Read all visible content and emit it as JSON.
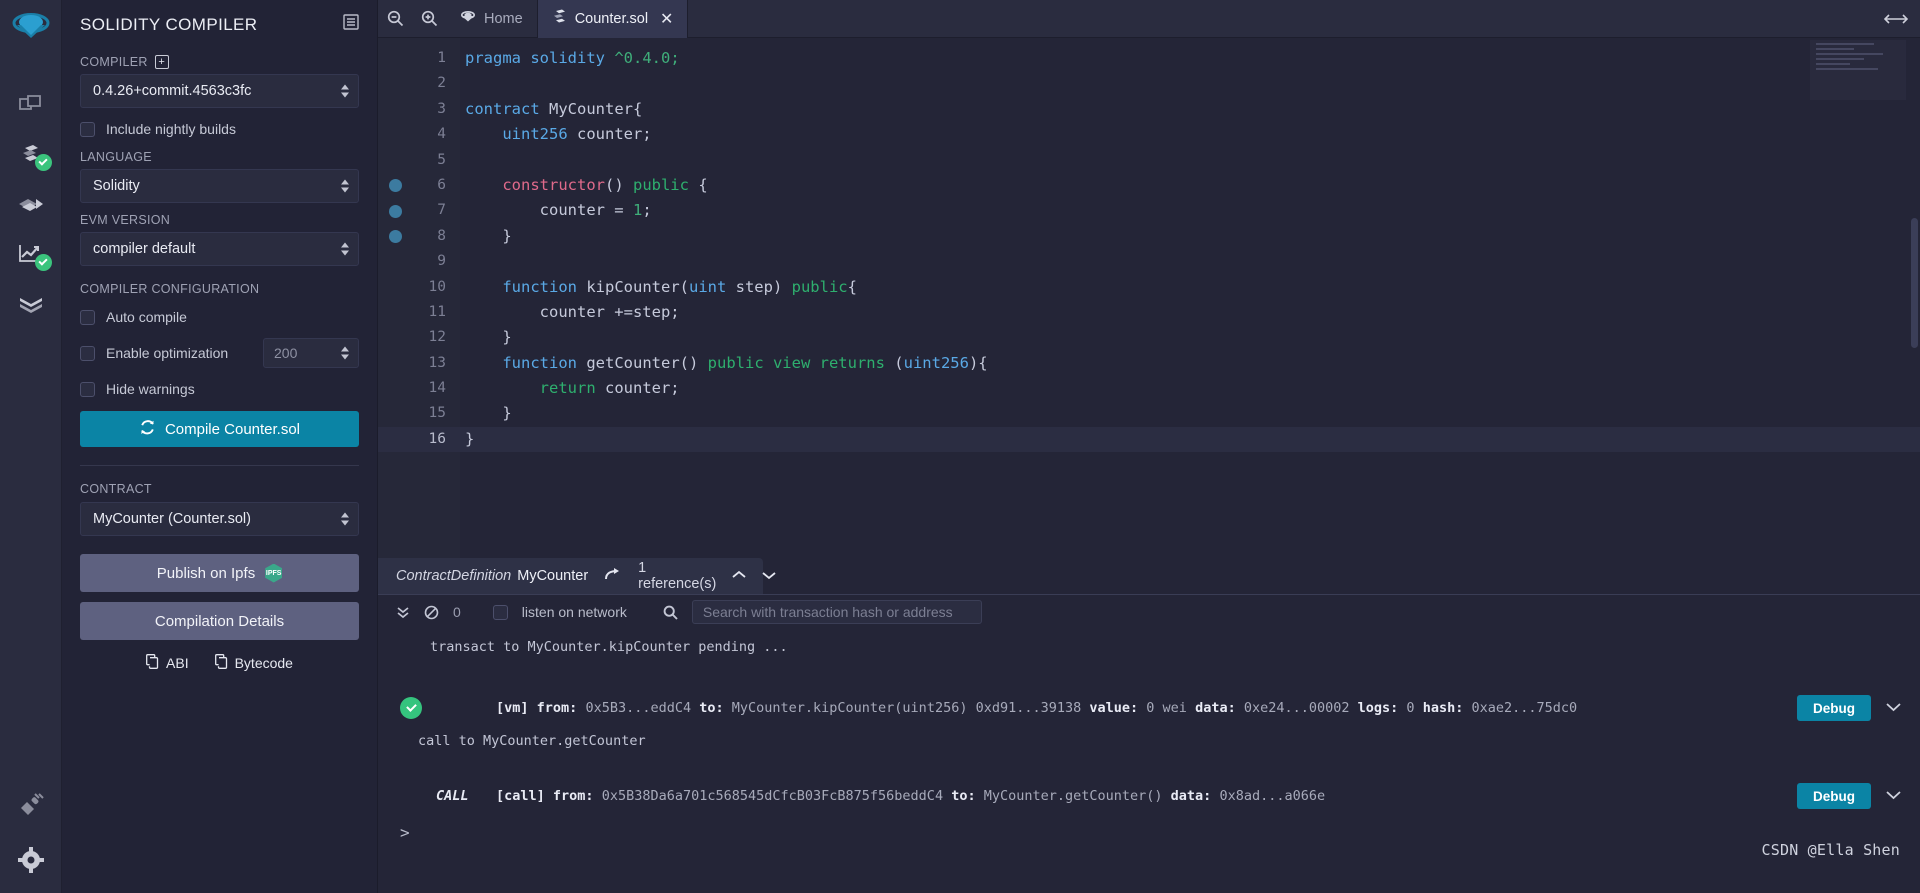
{
  "rail": {
    "items": [
      {
        "name": "logo",
        "icon": "remix-logo-icon",
        "badge": false
      },
      {
        "name": "file-explorer",
        "icon": "files-icon",
        "badge": false
      },
      {
        "name": "solidity-compiler",
        "icon": "solidity-compiler-icon",
        "badge": true
      },
      {
        "name": "deploy-run",
        "icon": "deploy-run-icon",
        "badge": false
      },
      {
        "name": "analysis",
        "icon": "analysis-chart-icon",
        "badge": true
      },
      {
        "name": "debugger",
        "icon": "debugger-chevrons-icon",
        "badge": false
      }
    ],
    "bottom": [
      {
        "name": "plugin-manager",
        "icon": "plug-icon"
      },
      {
        "name": "settings",
        "icon": "gear-icon"
      }
    ]
  },
  "panel": {
    "title": "SOLIDITY COMPILER",
    "head_icon": "list-view-icon",
    "compiler_label": "COMPILER",
    "compiler_plus": "+",
    "compiler_version": "0.4.26+commit.4563c3fc",
    "nightly_label": "Include nightly builds",
    "language_label": "LANGUAGE",
    "language_value": "Solidity",
    "evm_label": "EVM VERSION",
    "evm_value": "compiler default",
    "config_label": "COMPILER CONFIGURATION",
    "auto_compile_label": "Auto compile",
    "enable_opt_label": "Enable optimization",
    "runs_value": "200",
    "hide_warnings_label": "Hide warnings",
    "compile_button": "Compile Counter.sol",
    "compile_icon": "refresh-icon",
    "contract_label": "CONTRACT",
    "contract_value": "MyCounter (Counter.sol)",
    "publish_button": "Publish on Ipfs",
    "publish_badge": "IPFS",
    "details_button": "Compilation Details",
    "abi_label": "ABI",
    "bytecode_label": "Bytecode",
    "copy_icon": "copy-icon"
  },
  "tabbar": {
    "zoom_out": "zoom-out-icon",
    "zoom_in": "zoom-in-icon",
    "tabs": [
      {
        "label": "Home",
        "icon": "remix-home-icon",
        "active": false,
        "closable": false
      },
      {
        "label": "Counter.sol",
        "icon": "solidity-file-icon",
        "active": true,
        "closable": true
      }
    ],
    "close_glyph": "✕",
    "collapse_icon": "expand-arrows-icon"
  },
  "editor": {
    "lines": [
      {
        "n": "1",
        "bp": false,
        "indent": 0,
        "tokens": [
          {
            "t": "pragma ",
            "c": "k-pragma"
          },
          {
            "t": "solidity ",
            "c": "k-kw"
          },
          {
            "t": "^0.4.0;",
            "c": "k-num"
          }
        ]
      },
      {
        "n": "2",
        "bp": false,
        "indent": 0,
        "tokens": []
      },
      {
        "n": "3",
        "bp": false,
        "indent": 0,
        "tokens": [
          {
            "t": "contract ",
            "c": "k-kw"
          },
          {
            "t": "MyCounter{",
            "c": "k-plain"
          }
        ]
      },
      {
        "n": "4",
        "bp": false,
        "indent": 1,
        "tokens": [
          {
            "t": "    ",
            "c": "k-plain"
          },
          {
            "t": "uint256",
            "c": "k-type"
          },
          {
            "t": " counter;",
            "c": "k-plain"
          }
        ]
      },
      {
        "n": "5",
        "bp": false,
        "indent": 1,
        "tokens": []
      },
      {
        "n": "6",
        "bp": true,
        "indent": 1,
        "tokens": [
          {
            "t": "    ",
            "c": "k-plain"
          },
          {
            "t": "constructor",
            "c": "k-ctor"
          },
          {
            "t": "() ",
            "c": "k-plain"
          },
          {
            "t": "public",
            "c": "k-mod"
          },
          {
            "t": " {",
            "c": "k-plain"
          }
        ]
      },
      {
        "n": "7",
        "bp": true,
        "indent": 2,
        "tokens": [
          {
            "t": "        counter = ",
            "c": "k-plain"
          },
          {
            "t": "1",
            "c": "k-num"
          },
          {
            "t": ";",
            "c": "k-plain"
          }
        ]
      },
      {
        "n": "8",
        "bp": true,
        "indent": 1,
        "tokens": [
          {
            "t": "    }",
            "c": "k-plain"
          }
        ]
      },
      {
        "n": "9",
        "bp": false,
        "indent": 1,
        "tokens": []
      },
      {
        "n": "10",
        "bp": false,
        "indent": 1,
        "tokens": [
          {
            "t": "    ",
            "c": "k-plain"
          },
          {
            "t": "function ",
            "c": "k-kw"
          },
          {
            "t": "kipCounter(",
            "c": "k-plain"
          },
          {
            "t": "uint",
            "c": "k-type"
          },
          {
            "t": " step) ",
            "c": "k-plain"
          },
          {
            "t": "public",
            "c": "k-mod"
          },
          {
            "t": "{",
            "c": "k-plain"
          }
        ]
      },
      {
        "n": "11",
        "bp": false,
        "indent": 2,
        "tokens": [
          {
            "t": "        counter +=step;",
            "c": "k-plain"
          }
        ]
      },
      {
        "n": "12",
        "bp": false,
        "indent": 1,
        "tokens": [
          {
            "t": "    }",
            "c": "k-plain"
          }
        ]
      },
      {
        "n": "13",
        "bp": false,
        "indent": 1,
        "tokens": [
          {
            "t": "    ",
            "c": "k-plain"
          },
          {
            "t": "function ",
            "c": "k-kw"
          },
          {
            "t": "getCounter() ",
            "c": "k-plain"
          },
          {
            "t": "public view returns ",
            "c": "k-ret"
          },
          {
            "t": "(",
            "c": "k-plain"
          },
          {
            "t": "uint256",
            "c": "k-type"
          },
          {
            "t": "){",
            "c": "k-plain"
          }
        ]
      },
      {
        "n": "14",
        "bp": false,
        "indent": 2,
        "tokens": [
          {
            "t": "        ",
            "c": "k-plain"
          },
          {
            "t": "return",
            "c": "k-mod"
          },
          {
            "t": " counter;",
            "c": "k-plain"
          }
        ]
      },
      {
        "n": "15",
        "bp": false,
        "indent": 1,
        "tokens": [
          {
            "t": "    }",
            "c": "k-plain"
          }
        ]
      },
      {
        "n": "16",
        "bp": false,
        "indent": 0,
        "current": true,
        "tokens": [
          {
            "t": "}",
            "c": "k-plain"
          }
        ]
      }
    ]
  },
  "context": {
    "kind": "ContractDefinition",
    "name": "MyCounter",
    "jump_icon": "goto-reference-icon",
    "references": "1 reference(s)",
    "up_icon": "chevron-up-icon",
    "down_icon": "chevron-down-icon"
  },
  "terminal": {
    "toolbar": {
      "collapse_icon": "double-chevron-down-icon",
      "clear_icon": "no-entry-clear-icon",
      "pending_count": "0",
      "listen_label": "listen on network",
      "search_icon": "search-icon",
      "search_placeholder": "Search with transaction hash or address"
    },
    "pending_line": "transact to MyCounter.kipCounter pending ...",
    "call_note": "call to MyCounter.getCounter",
    "entries": [
      {
        "status": "ok",
        "tag": "",
        "vm": "[vm]",
        "fields": [
          {
            "label": "from:",
            "value": "0x5B3...eddC4"
          },
          {
            "label": "to:",
            "value": "MyCounter.kipCounter(uint256) 0xd91...39138"
          },
          {
            "label": "value:",
            "value": "0 wei"
          },
          {
            "label": "data:",
            "value": "0xe24...00002"
          },
          {
            "label": "logs:",
            "value": "0"
          },
          {
            "label": "hash:",
            "value": "0xae2...75dc0"
          }
        ],
        "debug_label": "Debug",
        "chevron_icon": "chevron-down-icon"
      },
      {
        "status": "none",
        "tag": "CALL",
        "vm": "[call]",
        "fields": [
          {
            "label": "from:",
            "value": "0x5B38Da6a701c568545dCfcB03FcB875f56beddC4"
          },
          {
            "label": "to:",
            "value": "MyCounter.getCounter()"
          },
          {
            "label": "data:",
            "value": "0x8ad...a066e"
          }
        ],
        "debug_label": "Debug",
        "chevron_icon": "chevron-down-icon"
      }
    ],
    "prompt": ">"
  },
  "watermark": "CSDN @Ella Shen",
  "colors": {
    "accent": "#0b84a5",
    "panel_bg": "#222336",
    "rail_bg": "#2a2c3f",
    "ok_green": "#35c47e",
    "grey_button": "#5e6180"
  }
}
